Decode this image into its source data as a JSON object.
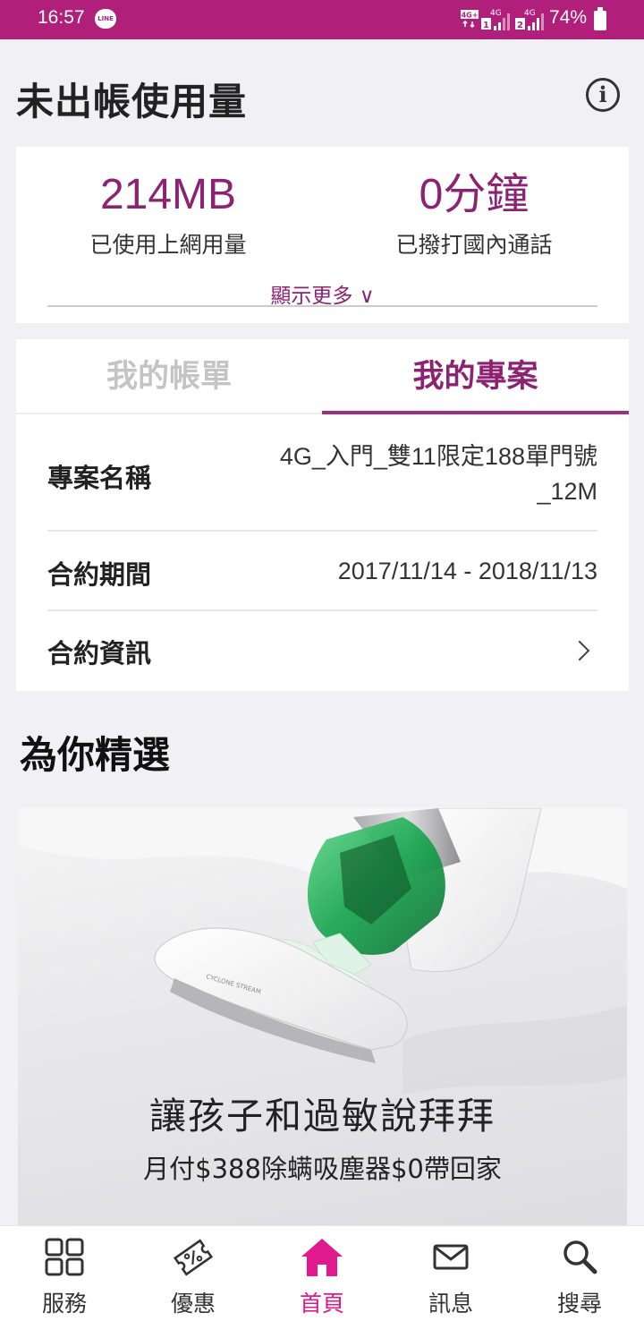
{
  "status_bar": {
    "time": "16:57",
    "line_badge": "LINE",
    "network_1": "4G+",
    "network_2": "4G",
    "sim_1": "1",
    "network_3": "4G",
    "sim_2": "2",
    "battery": "74%"
  },
  "header": {
    "title": "未出帳使用量",
    "info_icon": "info-icon"
  },
  "usage": {
    "data_value": "214MB",
    "data_label": "已使用上網用量",
    "voice_value": "0分鐘",
    "voice_label": "已撥打國內通話",
    "show_more": "顯示更多 ∨"
  },
  "tabs": {
    "bill": "我的帳單",
    "plan": "我的專案",
    "active": "plan"
  },
  "plan": {
    "name_label": "專案名稱",
    "name_value_line1": "4G_入門_雙11限定188單門號",
    "name_value_line2": "_12M",
    "period_label": "合約期間",
    "period_value": "2017/11/14 - 2018/11/13",
    "info_label": "合約資訊"
  },
  "featured": {
    "section_title": "為你精選",
    "banner_headline": "讓孩子和過敏說拜拜",
    "banner_sub": "月付$388除螨吸塵器$0帶回家",
    "banner_product_text": "CYCLONE STREAM"
  },
  "bottom_nav": {
    "services": "服務",
    "offers": "優惠",
    "home": "首頁",
    "messages": "訊息",
    "search": "搜尋",
    "active": "home",
    "colors": {
      "active": "#e01a8c",
      "inactive": "#333333"
    }
  },
  "colors": {
    "status_bar": "#b01f7a",
    "accent": "#8c2372",
    "background": "#f1f0f4"
  }
}
